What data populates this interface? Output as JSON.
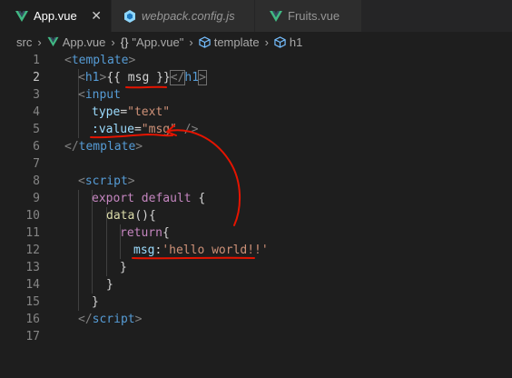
{
  "tabs": [
    {
      "label": "App.vue",
      "icon": "vue-icon",
      "close": "✕"
    },
    {
      "label": "webpack.config.js",
      "icon": "webpack-icon"
    },
    {
      "label": "Fruits.vue",
      "icon": "vue-icon"
    }
  ],
  "breadcrumb": {
    "items": [
      "src",
      "App.vue",
      "\"App.vue\"",
      "template",
      "h1"
    ],
    "braces_icon_text": "{}"
  },
  "line_numbers": [
    "1",
    "2",
    "3",
    "4",
    "5",
    "6",
    "7",
    "8",
    "9",
    "10",
    "11",
    "12",
    "13",
    "14",
    "15",
    "16",
    "17"
  ],
  "code": {
    "l1": {
      "open": "<",
      "tag": "template",
      "close": ">"
    },
    "l2": {
      "open": "<",
      "tag": "h1",
      "close": ">",
      "text": "{{ msg }}",
      "end_open": "</",
      "end_tag": "h1",
      "end_close": ">"
    },
    "l3": {
      "open": "<",
      "tag": "input"
    },
    "l4": {
      "attr": "type",
      "eq": "=",
      "val": "\"text\""
    },
    "l5": {
      "attr": ":value",
      "eq": "=",
      "val": "\"msg\"",
      "end": " />"
    },
    "l6": {
      "open": "</",
      "tag": "template",
      "close": ">"
    },
    "l8": {
      "open": "<",
      "tag": "script",
      "close": ">"
    },
    "l9": {
      "kw1": "export",
      "kw2": "default",
      "brace": "{"
    },
    "l10": {
      "fn": "data",
      "rest": "(){"
    },
    "l11": {
      "kw": "return",
      "rest": "{"
    },
    "l12": {
      "key": "msg",
      "colon": ":",
      "val": "'hello world!!'"
    },
    "l13": {
      "text": "}"
    },
    "l14": {
      "text": "}"
    },
    "l15": {
      "text": "}"
    },
    "l16": {
      "open": "</",
      "tag": "script",
      "close": ">"
    }
  },
  "colors": {
    "background": "#1e1e1e",
    "annotation": "#e51400",
    "vue_green": "#41b883",
    "webpack_blue": "#4a90d9"
  }
}
